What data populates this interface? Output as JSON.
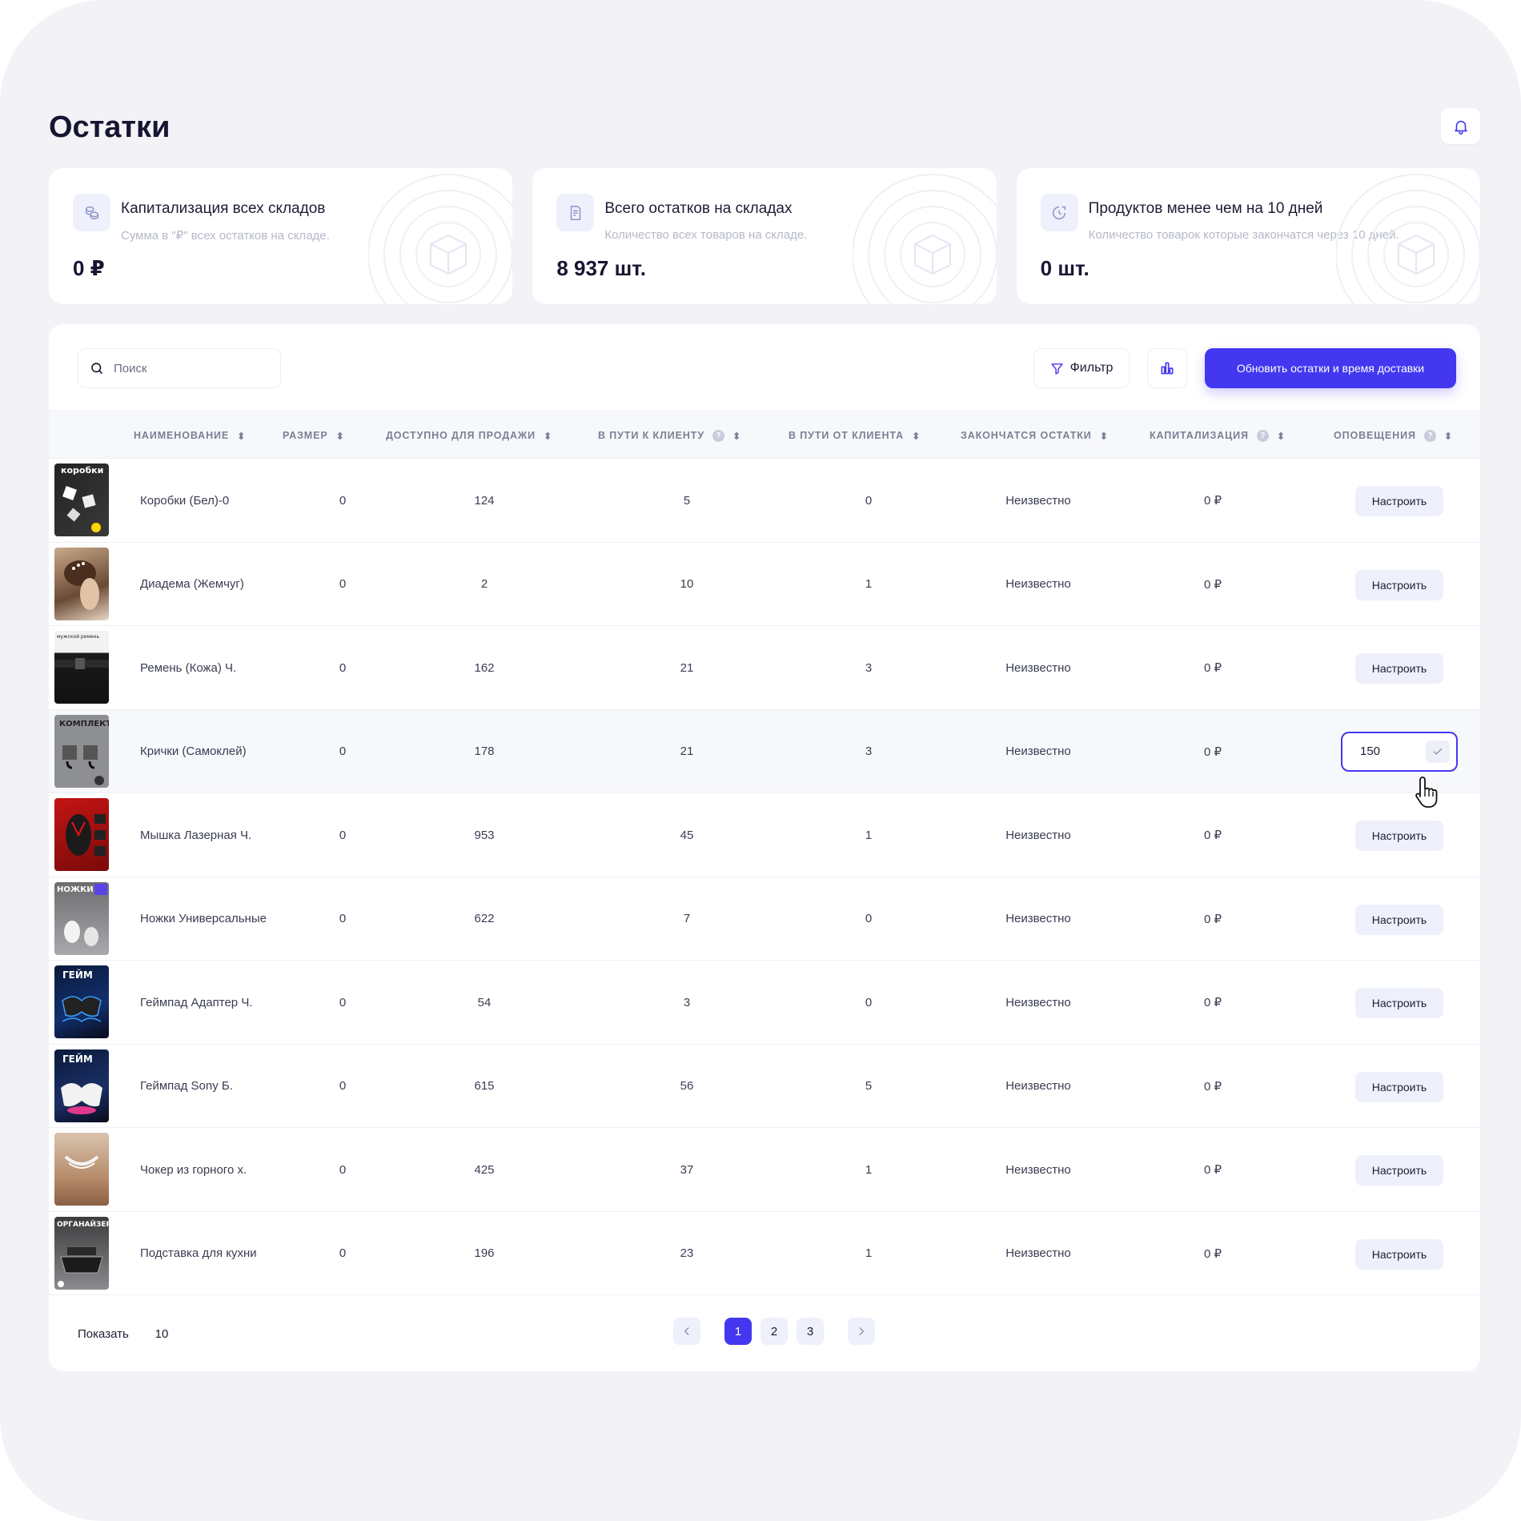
{
  "page": {
    "title": "Остатки"
  },
  "cards": [
    {
      "title": "Капитализация всех складов",
      "subtitle": "Сумма в \"₽\" всех остатков на складе.",
      "value": "0 ₽",
      "icon": "coins-icon"
    },
    {
      "title": "Всего остатков на складах",
      "subtitle": "Количество всех товаров на складе.",
      "value": "8 937 шт.",
      "icon": "receipt-icon"
    },
    {
      "title": "Продуктов менее чем на 10 дней",
      "subtitle": "Количество товарок которые закончатся через 10 дней.",
      "value": "0 шт.",
      "icon": "clock-box-icon"
    }
  ],
  "toolbar": {
    "search_placeholder": "Поиск",
    "filter_label": "Фильтр",
    "update_label": "Обновить остатки и время доставки"
  },
  "table": {
    "columns": [
      "НАИМЕНОВАНИЕ",
      "РАЗМЕР",
      "ДОСТУПНО ДЛЯ ПРОДАЖИ",
      "В ПУТИ К КЛИЕНТУ",
      "В ПУТИ ОТ КЛИЕНТА",
      "ЗАКОНЧАТСЯ ОСТАТКИ",
      "КАПИТАЛИЗАЦИЯ",
      "ОПОВЕЩЕНИЯ"
    ],
    "rows": [
      {
        "name": "Коробки (Бел)-0",
        "size": "0",
        "available": "124",
        "to_client": "5",
        "from_client": "0",
        "ends": "Неизвестно",
        "cap": "0 ₽",
        "action": "Настроить"
      },
      {
        "name": "Диадема (Жемчуг)",
        "size": "0",
        "available": "2",
        "to_client": "10",
        "from_client": "1",
        "ends": "Неизвестно",
        "cap": "0 ₽",
        "action": "Настроить"
      },
      {
        "name": "Ремень (Кожа) Ч.",
        "size": "0",
        "available": "162",
        "to_client": "21",
        "from_client": "3",
        "ends": "Неизвестно",
        "cap": "0 ₽",
        "action": "Настроить"
      },
      {
        "name": "Крички (Самоклей)",
        "size": "0",
        "available": "178",
        "to_client": "21",
        "from_client": "3",
        "ends": "Неизвестно",
        "cap": "0 ₽",
        "action": "150"
      },
      {
        "name": "Мышка Лазерная Ч.",
        "size": "0",
        "available": "953",
        "to_client": "45",
        "from_client": "1",
        "ends": "Неизвестно",
        "cap": "0 ₽",
        "action": "Настроить"
      },
      {
        "name": "Ножки Универсальные",
        "size": "0",
        "available": "622",
        "to_client": "7",
        "from_client": "0",
        "ends": "Неизвестно",
        "cap": "0 ₽",
        "action": "Настроить"
      },
      {
        "name": "Геймпад Адаптер Ч.",
        "size": "0",
        "available": "54",
        "to_client": "3",
        "from_client": "0",
        "ends": "Неизвестно",
        "cap": "0 ₽",
        "action": "Настроить"
      },
      {
        "name": "Геймпад Sony Б.",
        "size": "0",
        "available": "615",
        "to_client": "56",
        "from_client": "5",
        "ends": "Неизвестно",
        "cap": "0 ₽",
        "action": "Настроить"
      },
      {
        "name": "Чокер из горного х.",
        "size": "0",
        "available": "425",
        "to_client": "37",
        "from_client": "1",
        "ends": "Неизвестно",
        "cap": "0 ₽",
        "action": "Настроить"
      },
      {
        "name": "Подставка для кухни",
        "size": "0",
        "available": "196",
        "to_client": "23",
        "from_client": "1",
        "ends": "Неизвестно",
        "cap": "0 ₽",
        "action": "Настроить"
      }
    ],
    "thumb_texts": [
      "коробки",
      "",
      "мужской ремень",
      "КОМПЛЕКТ",
      "",
      "НОЖКИ",
      "ГЕЙМ",
      "ГЕЙМ",
      "",
      "ОРГАНАЙЗЕР"
    ]
  },
  "footer": {
    "show_label": "Показать",
    "page_size": "10",
    "pages": [
      "1",
      "2",
      "3"
    ],
    "current_page": "1"
  },
  "colors": {
    "accent": "#4338f0",
    "background": "#f3f3f7"
  }
}
